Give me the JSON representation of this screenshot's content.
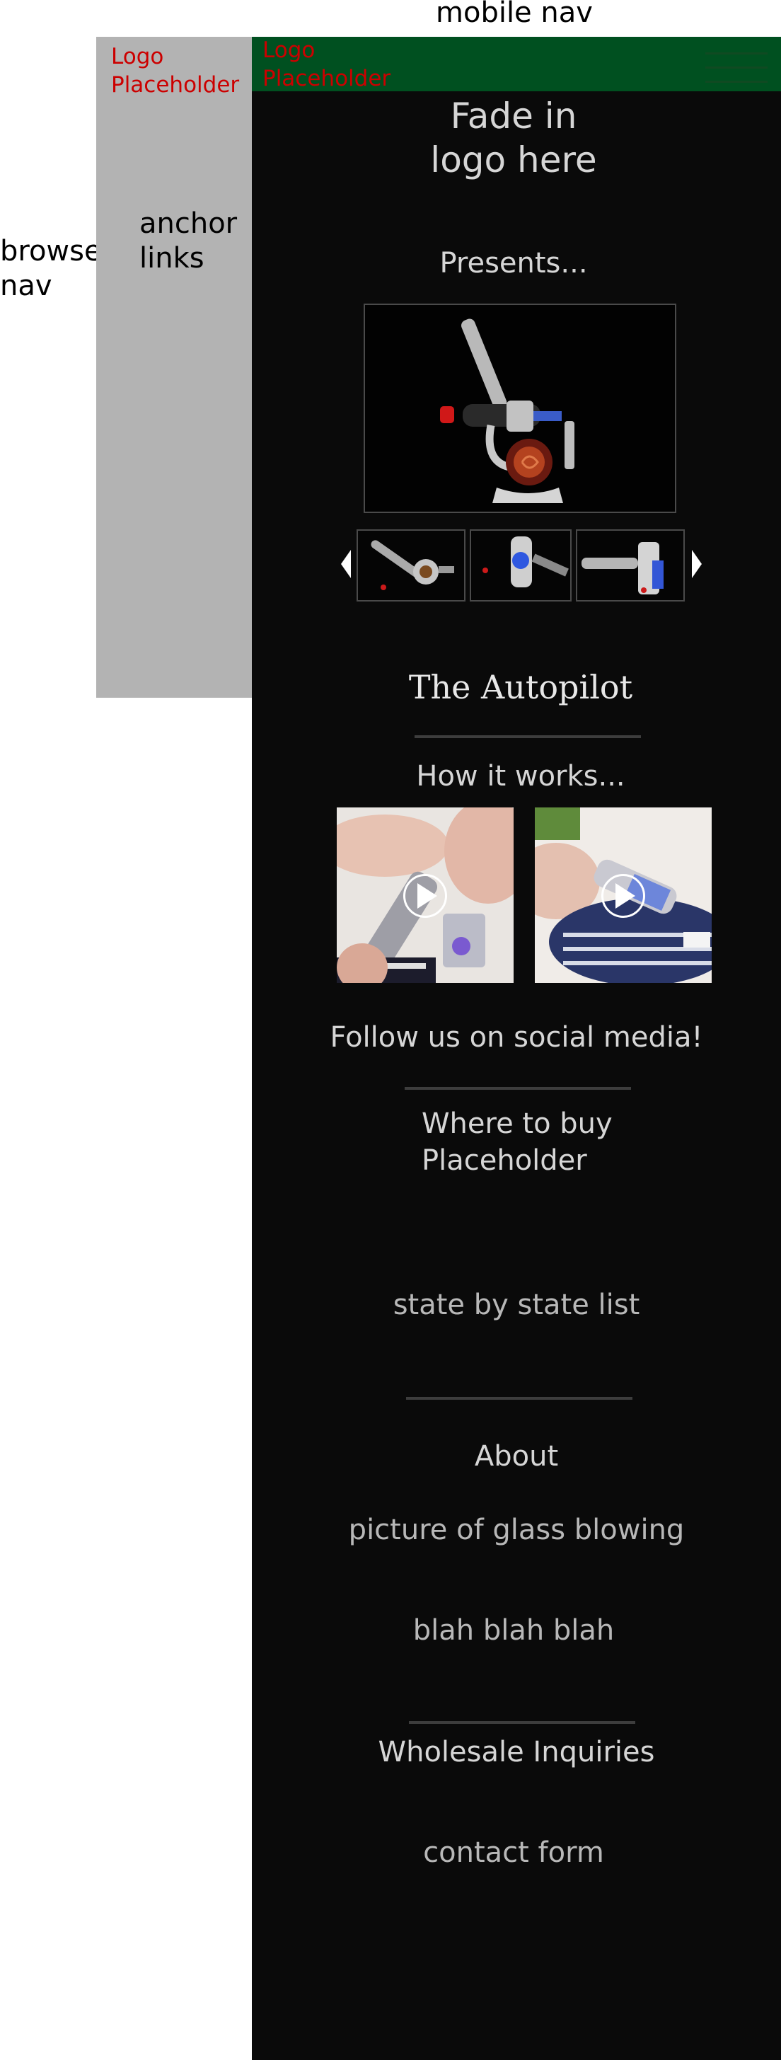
{
  "annotations": {
    "mobile_nav": "mobile nav",
    "browser_nav_line1": "browser",
    "browser_nav_line2": "nav",
    "anchor_links_line1": "anchor",
    "anchor_links_line2": "links"
  },
  "browser_nav": {
    "logo_line1": "Logo",
    "logo_line2": "Placeholder"
  },
  "mobile_header": {
    "logo_line1": "Logo",
    "logo_line2": "Placeholder",
    "menu_icon": "hamburger-menu-icon"
  },
  "hero": {
    "fade_line1": "Fade in",
    "fade_line2": "logo here",
    "presents": "Presents..."
  },
  "product": {
    "name": "The Autopilot"
  },
  "how_it_works": {
    "heading": "How it works..."
  },
  "social": {
    "heading": "Follow us on social media!"
  },
  "where_to_buy": {
    "heading_line1": "Where to buy",
    "heading_line2": "Placeholder",
    "content": "state by state list"
  },
  "about": {
    "heading": "About",
    "picture": "picture of glass blowing",
    "text": "blah blah blah"
  },
  "wholesale": {
    "heading": "Wholesale Inquiries",
    "form": "contact form"
  },
  "colors": {
    "header_green": "#005020",
    "logo_red": "#cc0000",
    "sidebar_grey": "#b3b3b3",
    "screen_bg": "#0a0a0a"
  }
}
